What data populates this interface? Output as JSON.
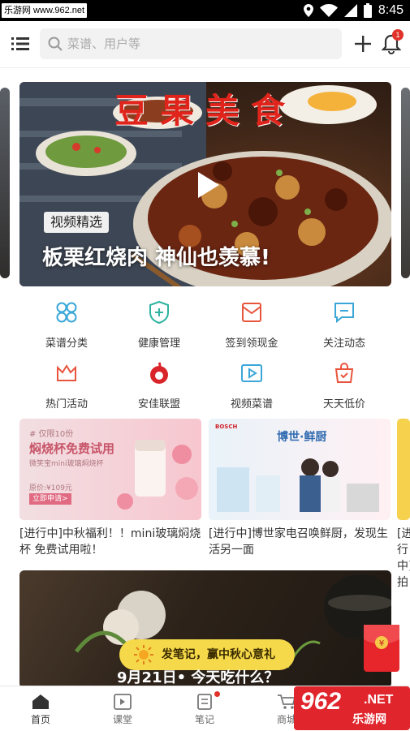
{
  "status_bar": {
    "site_tag": "乐游网 www.962.net",
    "time": "8:45"
  },
  "header": {
    "search_placeholder": "菜谱、用户等",
    "notification_count": "1"
  },
  "hero": {
    "title": "豆果美食",
    "tag": "视频精选",
    "caption": "板栗红烧肉 神仙也羡慕!"
  },
  "grid": [
    {
      "label": "菜谱分类",
      "icon": "category-icon",
      "color": "#3aa7d8"
    },
    {
      "label": "健康管理",
      "icon": "health-shield-icon",
      "color": "#2fb3a0"
    },
    {
      "label": "签到领现金",
      "icon": "checkin-envelope-icon",
      "color": "#e8553d"
    },
    {
      "label": "关注动态",
      "icon": "message-icon",
      "color": "#3aa7d8"
    },
    {
      "label": "热门活动",
      "icon": "crown-icon",
      "color": "#e8553d"
    },
    {
      "label": "安佳联盟",
      "icon": "anchor-brand-icon",
      "color": "#d9242a"
    },
    {
      "label": "视频菜谱",
      "icon": "video-icon",
      "color": "#3aa7d8"
    },
    {
      "label": "天天低价",
      "icon": "shopping-bag-icon",
      "color": "#e8553d"
    }
  ],
  "cards": [
    {
      "text": "[进行中]中秋福利！！mini玻璃焖烧杯 免费试用啦！",
      "promo_small": "# 仅限10份",
      "promo_title": "焖烧杯免费试用",
      "promo_sub": "微笑宝mini玻璃焖烧杯",
      "promo_price": "原价:¥109元",
      "promo_button": "立即申请>"
    },
    {
      "text": "[进行中]博世家电召唤鲜厨，发现生活另一面",
      "brand": "BOSCH",
      "promo_title": "博世·鲜厨"
    },
    {
      "text": "[进行中] 拍"
    }
  ],
  "note_banner": {
    "pill_text": "发笔记，赢中秋心意礼",
    "caption": "9月21日• 今天吃什么？"
  },
  "tabs": [
    {
      "label": "首页",
      "icon": "home-icon"
    },
    {
      "label": "课堂",
      "icon": "classroom-play-icon"
    },
    {
      "label": "笔记",
      "icon": "notes-icon"
    },
    {
      "label": "商城",
      "icon": "cart-icon"
    }
  ],
  "watermark": {
    "big": "962",
    "small": "乐游网",
    "domain": ".NET"
  }
}
